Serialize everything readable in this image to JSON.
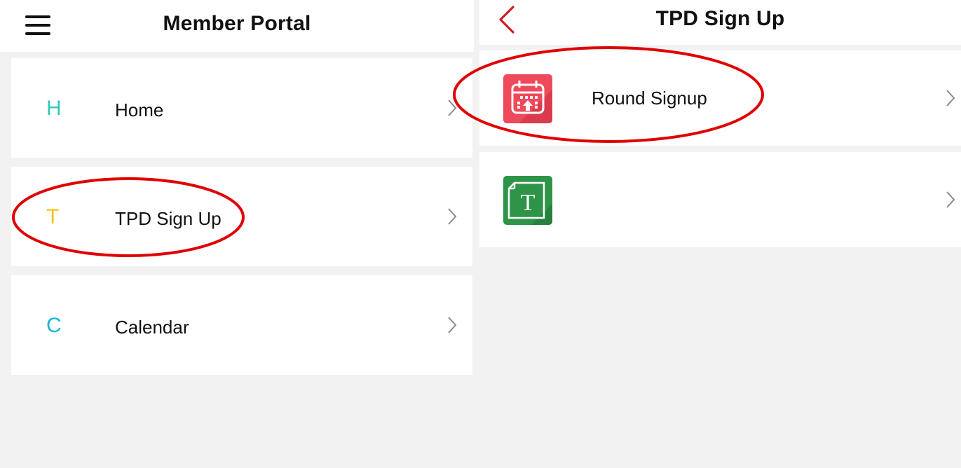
{
  "colors": {
    "accent_back": "#d01e1e",
    "annotation": "#e00000",
    "letter_home": "#2ecdb3",
    "letter_tpd": "#f0c419",
    "letter_calendar": "#1ab3d8"
  },
  "left_panel": {
    "title": "Member Portal",
    "menu_icon": "hamburger-menu-icon",
    "items": [
      {
        "letter": "H",
        "label": "Home"
      },
      {
        "letter": "T",
        "label": "TPD Sign Up"
      },
      {
        "letter": "C",
        "label": "Calendar"
      }
    ]
  },
  "right_panel": {
    "title": "TPD Sign Up",
    "back_icon": "chevron-left-icon",
    "items": [
      {
        "icon": "calendar-upload-icon",
        "label": "Round Signup"
      },
      {
        "icon": "text-document-icon",
        "label": ""
      }
    ]
  },
  "annotations": [
    "circle-tpd-sign-up",
    "circle-round-signup"
  ]
}
